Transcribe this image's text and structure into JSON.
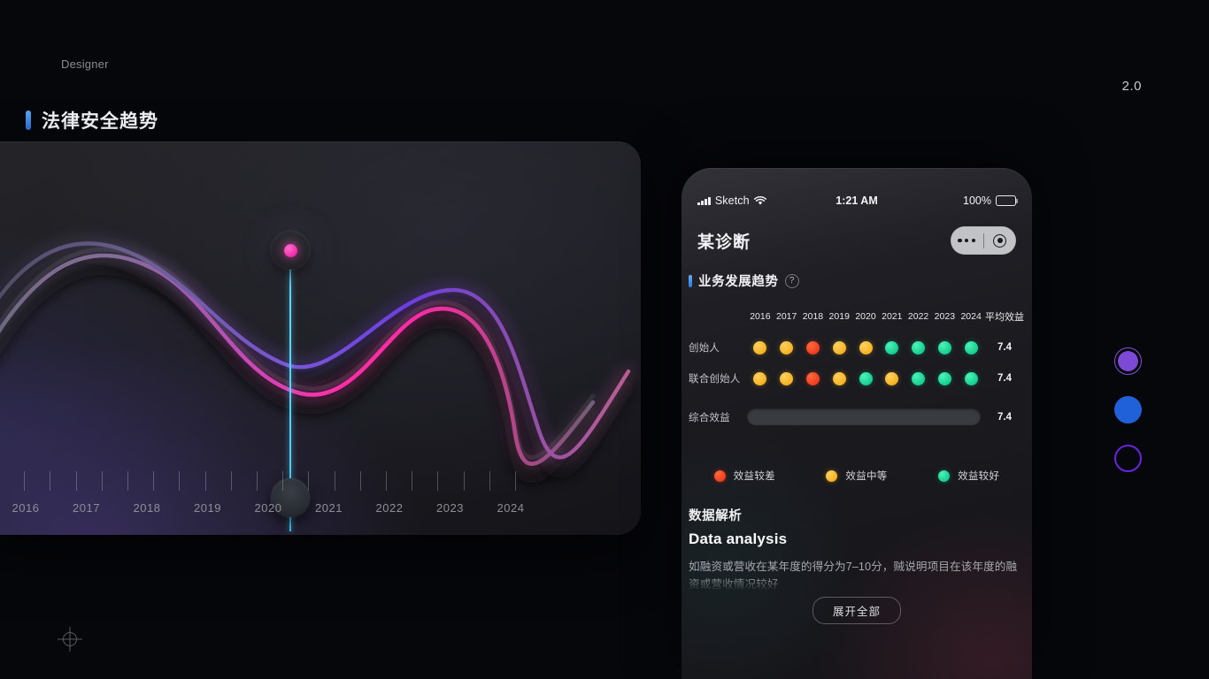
{
  "header": {
    "designer_label": "Designer",
    "version": "2.0",
    "page_title": "法律安全趋势"
  },
  "chart_card": {
    "years": [
      "2016",
      "2017",
      "2018",
      "2019",
      "2020",
      "2021",
      "2022",
      "2023",
      "2024"
    ],
    "selected_year": "2020",
    "scrubber_icon": "scrubber-handle-icon"
  },
  "chart_data": {
    "type": "line",
    "title": "法律安全趋势",
    "xlabel": "",
    "ylabel": "",
    "grid": false,
    "legend": "none",
    "x": [
      "2016",
      "2017",
      "2018",
      "2019",
      "2020",
      "2021",
      "2022",
      "2023",
      "2024"
    ],
    "xlim": [
      "2016",
      "2024"
    ],
    "ylim": [
      0,
      100
    ],
    "series": [
      {
        "name": "pink-series",
        "color_start": "#8e7ab0",
        "color_end": "#ff2fa8",
        "values": [
          72,
          86,
          74,
          52,
          60,
          84,
          88,
          18,
          22,
          56
        ]
      },
      {
        "name": "purple-series",
        "color_start": "#7a6fa8",
        "color_end": "#6b3fe0",
        "values": [
          66,
          70,
          58,
          36,
          34,
          58,
          82,
          80,
          40,
          74
        ]
      }
    ],
    "annotations": [
      {
        "type": "vertical-scrubber",
        "x": "2020",
        "color": "#4fcff7",
        "knob_color": "#ef2ba8"
      }
    ]
  },
  "swatches": [
    {
      "name": "swatch-purple-ring-fill",
      "color": "#7c4ad6"
    },
    {
      "name": "swatch-blue-solid",
      "color": "#2060d8"
    },
    {
      "name": "swatch-violet-ring",
      "color": "#6a23e0"
    }
  ],
  "phone": {
    "status_bar": {
      "carrier": "Sketch",
      "signal_icon": "signal-bars-icon",
      "wifi_icon": "wifi-icon",
      "time": "1:21 AM",
      "battery_percent": "100%",
      "battery_icon": "battery-full-icon"
    },
    "nav": {
      "title": "某诊断",
      "capsule": {
        "menu_icon": "three-dots-icon",
        "target_icon": "target-circle-icon"
      }
    },
    "section": {
      "title": "业务发展趋势",
      "help_icon": "question-mark-icon",
      "help_glyph": "?"
    },
    "matrix": {
      "year_headers": [
        "2016",
        "2017",
        "2018",
        "2019",
        "2020",
        "2021",
        "2022",
        "2023",
        "2024"
      ],
      "average_header": "平均效益",
      "rows": [
        {
          "label": "创始人",
          "ratings": [
            "yellow",
            "yellow",
            "red",
            "yellow",
            "yellow",
            "green",
            "green",
            "green",
            "green"
          ],
          "average": "7.4"
        },
        {
          "label": "联合创始人",
          "ratings": [
            "yellow",
            "yellow",
            "red",
            "yellow",
            "green",
            "yellow",
            "green",
            "green",
            "green"
          ],
          "average": "7.4"
        }
      ],
      "overall": {
        "label": "综合效益",
        "value": "7.4",
        "percent": 91
      }
    },
    "legend": [
      {
        "label": "效益较差",
        "color": "#ee3b21",
        "key": "red"
      },
      {
        "label": "效益中等",
        "color": "#f5b21f",
        "key": "yellow"
      },
      {
        "label": "效益较好",
        "color": "#14cc8f",
        "key": "green"
      }
    ],
    "analysis": {
      "title_zh": "数据解析",
      "title_en": "Data analysis",
      "body": "如融资或营收在某年度的得分为7–10分，贼说明项目在该年度的融资或营收情况较好",
      "expand_button": "展开全部"
    }
  },
  "marks": {
    "crosshair_icon": "registration-crosshair-icon"
  }
}
